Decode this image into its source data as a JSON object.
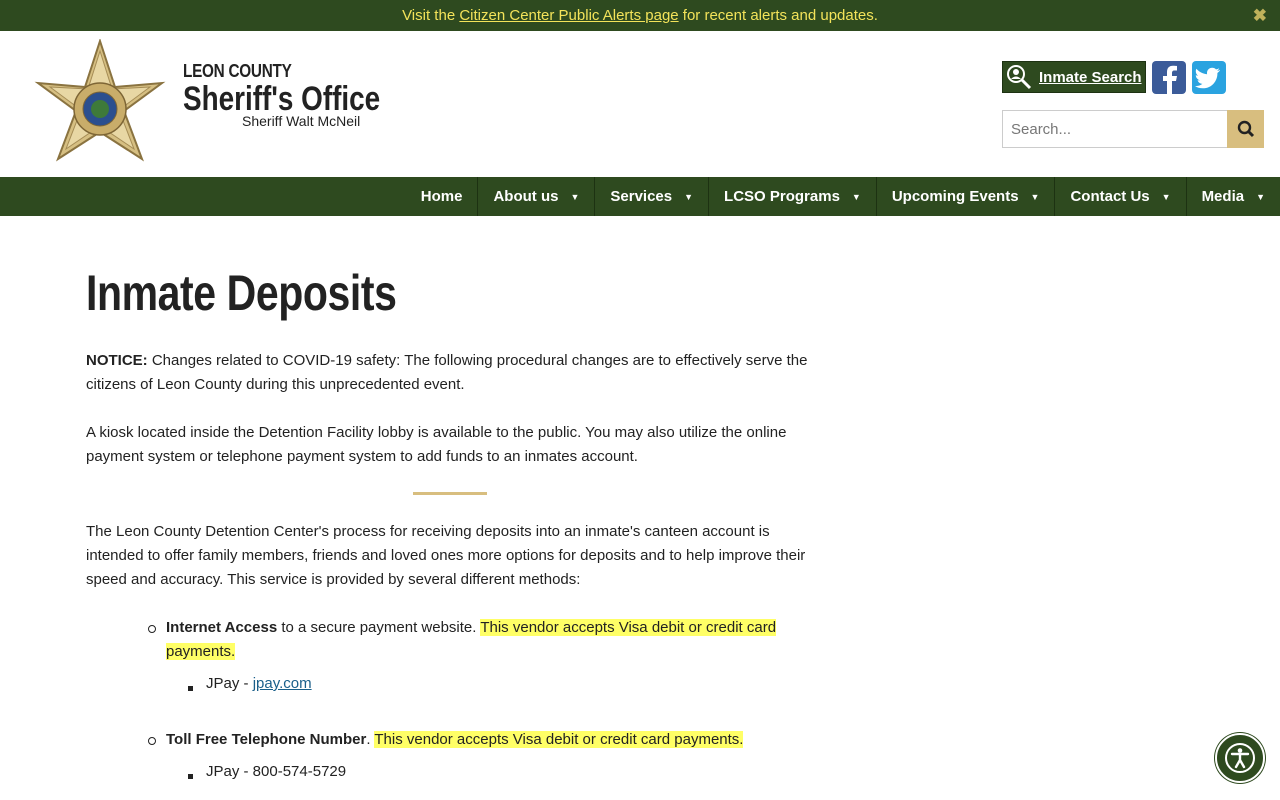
{
  "alert": {
    "prefix": "Visit the",
    "link": "Citizen Center Public Alerts page",
    "suffix": "for recent alerts and updates.",
    "close": "✖"
  },
  "brand": {
    "county": "LEON COUNTY",
    "office": "Sheriff's Office",
    "sheriff": "Sheriff Walt McNeil"
  },
  "header": {
    "inmate_search": "Inmate Search",
    "search_placeholder": "Search..."
  },
  "nav": {
    "items": [
      {
        "label": "Home",
        "dropdown": false
      },
      {
        "label": "About us",
        "dropdown": true
      },
      {
        "label": "Services",
        "dropdown": true
      },
      {
        "label": "LCSO Programs",
        "dropdown": true
      },
      {
        "label": "Upcoming Events",
        "dropdown": true
      },
      {
        "label": "Contact Us",
        "dropdown": true
      },
      {
        "label": "Media",
        "dropdown": true
      }
    ]
  },
  "page": {
    "title": "Inmate Deposits",
    "notice_label": "NOTICE:",
    "notice_text": "Changes related to COVID-19 safety: The following procedural changes are to effectively serve the citizens of Leon County during this unprecedented event.",
    "kiosk_text": "A kiosk located inside the Detention Facility lobby is available to the public. You may also utilize the online payment system or telephone payment system to add funds to an inmates account.",
    "process_text": "The Leon County Detention Center's process for receiving deposits into an inmate's canteen account is intended to offer family members, friends and loved ones more options for deposits and to help improve their speed and accuracy. This service is provided by several different methods:",
    "methods": [
      {
        "bold": "Internet Access",
        "text": " to a secure payment website. ",
        "highlight": "This vendor accepts Visa debit or credit card payments.",
        "sub_prefix": "JPay - ",
        "sub_link": "jpay.com"
      },
      {
        "bold": "Toll Free Telephone Number",
        "text": ". ",
        "highlight": "This vendor accepts Visa debit or credit card payments.",
        "sub_prefix": "JPay - 800-574-5729"
      }
    ]
  },
  "colors": {
    "brand_green": "#2e4a1f",
    "gold": "#d8be7f",
    "alert_text": "#f3e35a",
    "highlight": "#ffff66"
  },
  "icons": [
    "close-icon",
    "sheriff-badge-logo",
    "inmate-search-icon",
    "facebook-icon",
    "twitter-icon",
    "search-icon",
    "accessibility-icon"
  ]
}
